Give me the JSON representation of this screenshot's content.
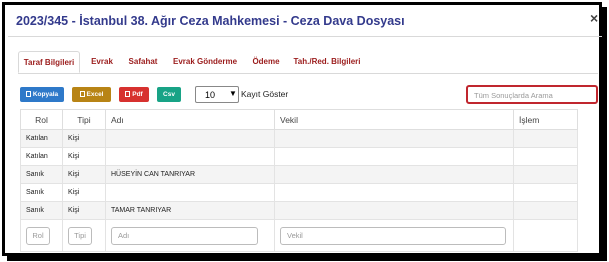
{
  "window": {
    "title": "2023/345 - İstanbul 38. Ağır Ceza Mahkemesi - Ceza Dava Dosyası",
    "close_label": "×"
  },
  "tabs": [
    {
      "label": "Taraf Bilgileri",
      "active": true
    },
    {
      "label": "Evrak"
    },
    {
      "label": "Safahat"
    },
    {
      "label": "Evrak Gönderme"
    },
    {
      "label": "Ödeme"
    },
    {
      "label": "Tah./Red. Bilgileri"
    }
  ],
  "toolbar": {
    "copy_label": "Kopyala",
    "excel_label": "Excel",
    "pdf_label": "Pdf",
    "csv_label": "Csv",
    "page_size": "10",
    "page_size_suffix": "Kayıt Göster",
    "search_placeholder": "Tüm Sonuçlarda Arama"
  },
  "colors": {
    "copy": "#2e79c9",
    "excel": "#b88415",
    "pdf": "#d7312f",
    "csv": "#18a386",
    "accent": "#c0262e",
    "title": "#333a8c"
  },
  "table": {
    "headers": [
      "Rol",
      "Tipi",
      "Adı",
      "Vekil",
      "İşlem"
    ],
    "rows": [
      {
        "rol": "Katılan",
        "tipi": "Kişi",
        "adi": "",
        "vekil": ""
      },
      {
        "rol": "Katılan",
        "tipi": "Kişi",
        "adi": "",
        "vekil": ""
      },
      {
        "rol": "Sanık",
        "tipi": "Kişi",
        "adi": "HÜSEYİN CAN TANRIYAR",
        "vekil": ""
      },
      {
        "rol": "Sanık",
        "tipi": "Kişi",
        "adi": "",
        "vekil": ""
      },
      {
        "rol": "Sanık",
        "tipi": "Kişi",
        "adi": "TAMAR TANRIYAR",
        "vekil": ""
      }
    ],
    "filters": {
      "rol": "Rol",
      "tipi": "Tipi",
      "adi": "Adı",
      "vekil": "Vekil"
    }
  }
}
